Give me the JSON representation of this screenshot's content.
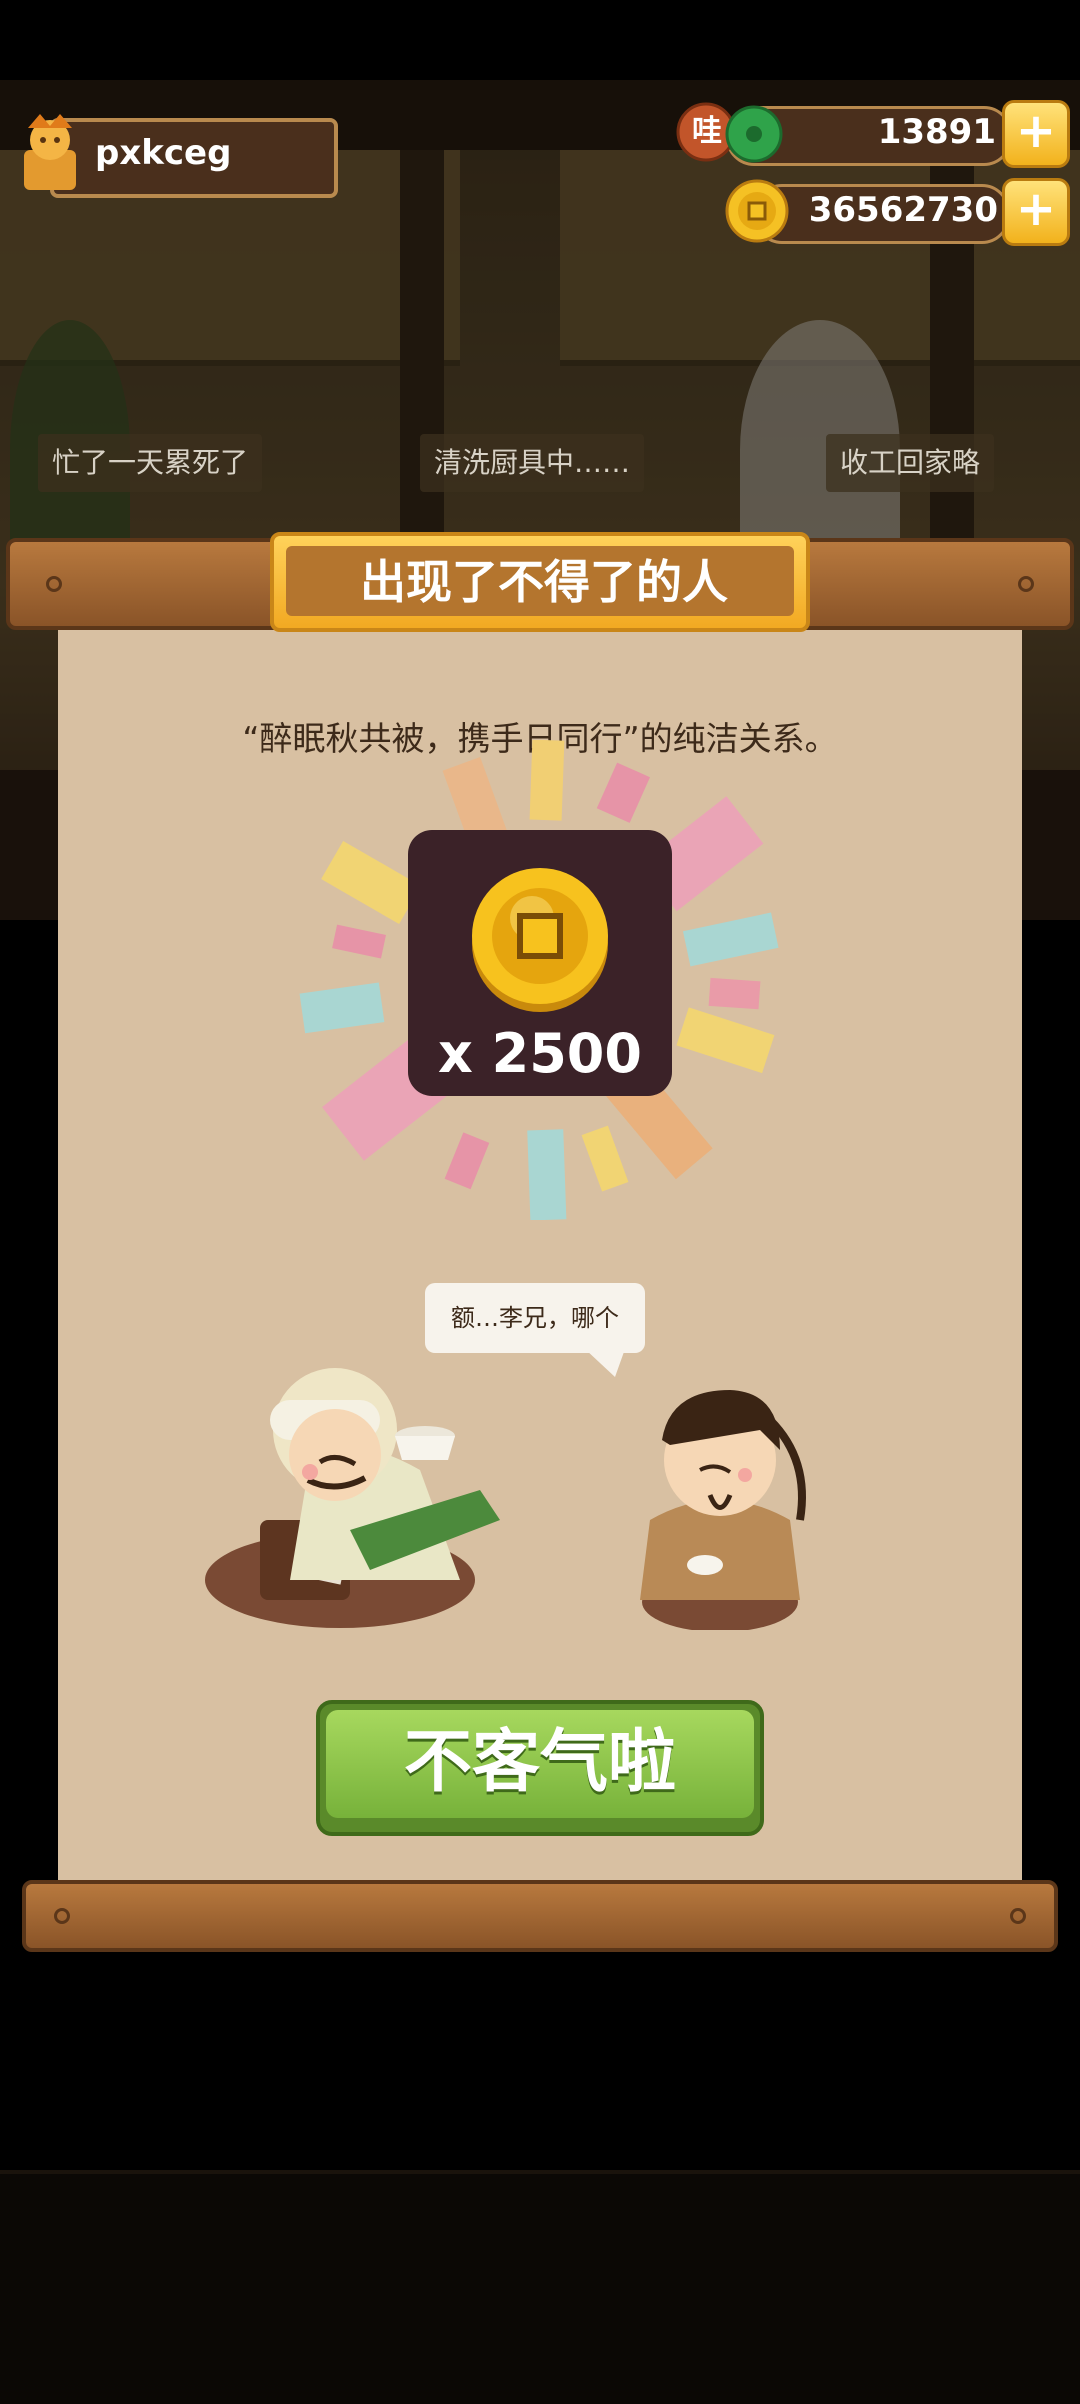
{
  "hud": {
    "player_name": "pxkceg",
    "jade_badge": "哇",
    "jade_value": "13891",
    "coin_value": "36562730",
    "plus": "+"
  },
  "scene": {
    "speech_left": "忙了一天累死了",
    "speech_center": "清洗厨具中……",
    "speech_right": "收工回家略"
  },
  "dialog": {
    "title": "出现了不得了的人",
    "description": "“醉眠秋共被，携手日同行”的纯洁关系。",
    "reward_amount": "x 2500",
    "speech_bubble": "额…李兄，哪个",
    "confirm_button": "不客气啦"
  },
  "colors": {
    "paper": "#d8c0a2",
    "title_plate": "#f2a922",
    "button_green": "#77b23a",
    "coin_gold": "#f2b21c"
  }
}
